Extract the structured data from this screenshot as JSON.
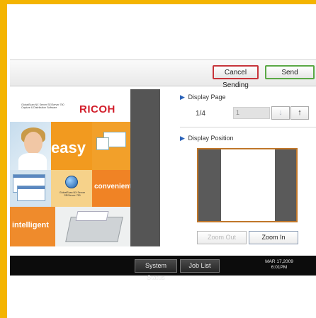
{
  "toolbar": {
    "cancel_sending_label": "Cancel Sending",
    "send_label": "Send"
  },
  "preview": {
    "brand_small_text": "GlobalScan NX Server SE/Server 750 Capture & Distribution Software",
    "brand_name": "RICOH",
    "tiles": {
      "easy": "easy",
      "convenient": "convenient",
      "intelligent": "intelligent",
      "globe_caption": "GlobalScan NX Server SE/Server 750"
    }
  },
  "display_page": {
    "title": "Display Page",
    "page_count": "1/4",
    "page_input_value": "1"
  },
  "display_position": {
    "title": "Display Position",
    "zoom_out_label": "Zoom Out",
    "zoom_in_label": "Zoom In"
  },
  "statusbar": {
    "system_status_label": "System Status",
    "job_list_label": "Job List",
    "date": "MAR  17,2009",
    "time": "6:01PM"
  },
  "colors": {
    "frame": "#f4b400",
    "cancel_border": "#c7343a",
    "send_border": "#5aa845",
    "ricoh_red": "#d21e2b",
    "position_border": "#c0772a"
  },
  "icons": {
    "section_arrow": "triangle-right-icon",
    "page_down": "arrow-down-icon",
    "page_up": "arrow-up-icon"
  }
}
